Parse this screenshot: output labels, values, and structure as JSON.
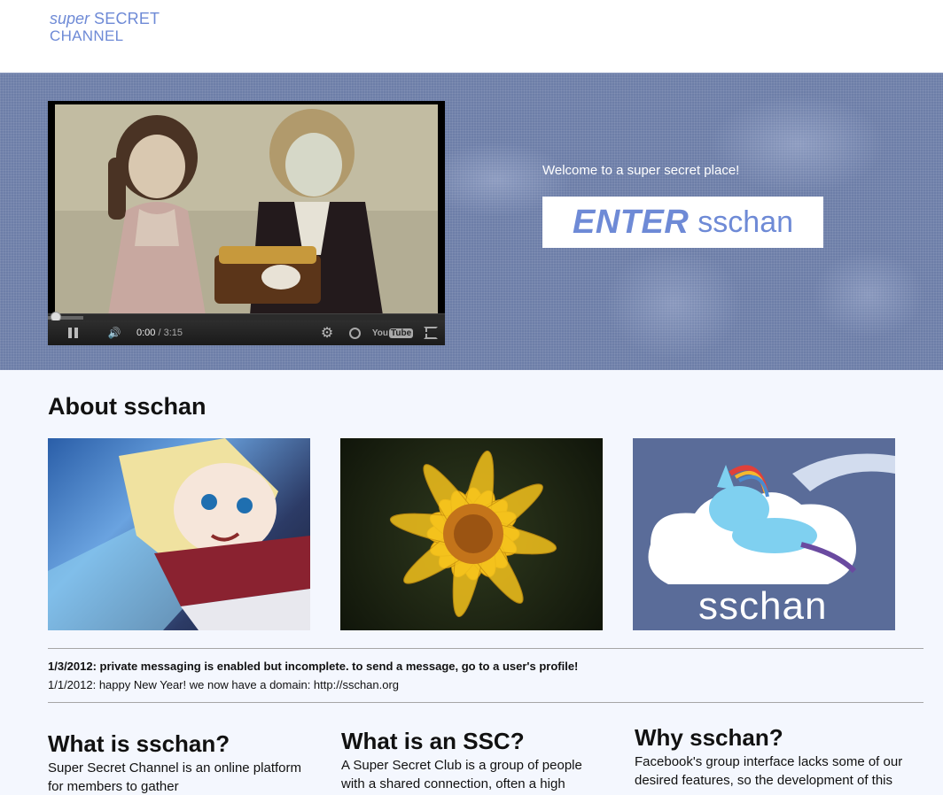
{
  "header": {
    "logo_line1_a": "super",
    "logo_line1_b": "SECRET",
    "logo_line2": "CHANNEL"
  },
  "hero": {
    "welcome": "Welcome to a super secret place!",
    "enter_big": "ENTER",
    "enter_small": "sschan",
    "player": {
      "time_current": "0:00",
      "time_total": "/ 3:15",
      "youtube_label": "You",
      "youtube_tube": "Tube",
      "progress_fraction": 0.0
    }
  },
  "about": {
    "title": "About sschan",
    "thumb3_text": "sschan"
  },
  "news": [
    "1/3/2012: private messaging is enabled but incomplete. to send a message, go to a user's profile!",
    "1/1/2012: happy New Year! we now have a domain: http://sschan.org"
  ],
  "columns": [
    {
      "title": "What is sschan?",
      "body": "Super Secret Channel is an online platform for members to gather"
    },
    {
      "title": "What is an SSC?",
      "body": "A Super Secret Club is a group of people with a shared connection, often a high"
    },
    {
      "title": "Why sschan?",
      "body": "Facebook's group interface lacks some of our desired features, so the development of this"
    }
  ],
  "colors": {
    "accent": "#6e8ad6",
    "hero_bg": "#6d7ea8",
    "page_bg": "#f4f7fe"
  }
}
